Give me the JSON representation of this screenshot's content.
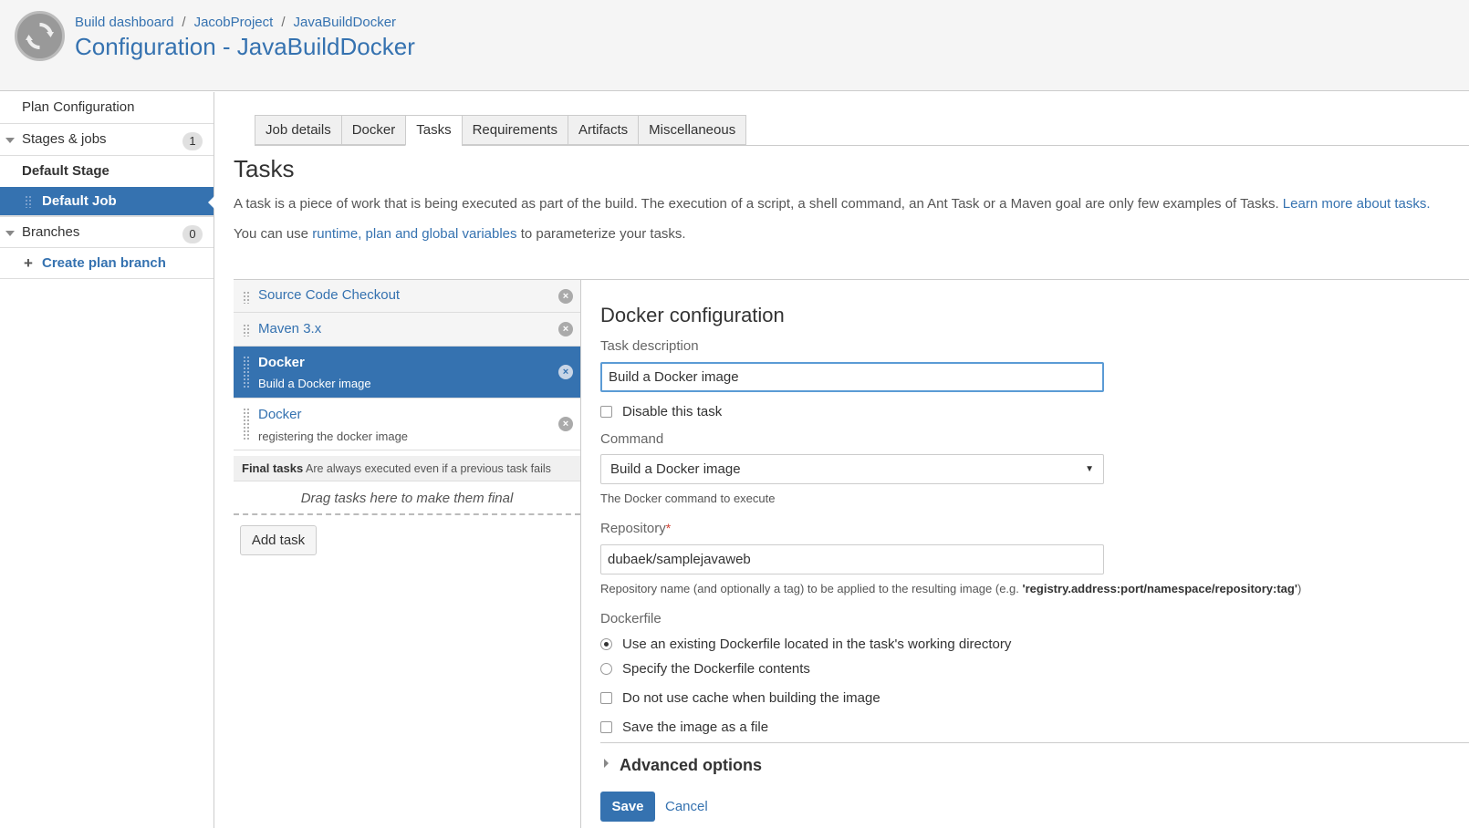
{
  "breadcrumb": {
    "items": [
      "Build dashboard",
      "JacobProject",
      "JavaBuildDocker"
    ],
    "separator": "/"
  },
  "page_title": "Configuration - JavaBuildDocker",
  "sidebar": {
    "plan_configuration": "Plan Configuration",
    "stages_jobs": {
      "label": "Stages & jobs",
      "count": "1"
    },
    "default_stage": "Default Stage",
    "default_job": "Default Job",
    "branches": {
      "label": "Branches",
      "count": "0"
    },
    "create_plan_branch": "Create plan branch"
  },
  "tabs": [
    "Job details",
    "Docker",
    "Tasks",
    "Requirements",
    "Artifacts",
    "Miscellaneous"
  ],
  "active_tab": "Tasks",
  "tasks_title": "Tasks",
  "description": {
    "line1_text": "A task is a piece of work that is being executed as part of the build. The execution of a script, a shell command, an Ant Task or a Maven goal are only few examples of Tasks.",
    "line1_link": "Learn more about tasks.",
    "line2_prefix": "You can use",
    "line2_link": "runtime, plan and global variables",
    "line2_suffix": "to parameterize your tasks."
  },
  "task_list": [
    {
      "name": "Source Code Checkout",
      "subtitle": ""
    },
    {
      "name": "Maven 3.x",
      "subtitle": ""
    },
    {
      "name": "Docker",
      "subtitle": "Build a Docker image"
    },
    {
      "name": "Docker",
      "subtitle": "registering the docker image"
    }
  ],
  "final_tasks": {
    "label": "Final tasks",
    "note": "Are always executed even if a previous task fails",
    "drop_hint": "Drag tasks here to make them final"
  },
  "add_task_label": "Add task",
  "config": {
    "title": "Docker configuration",
    "task_description_label": "Task description",
    "task_description_value": "Build a Docker image",
    "disable_task_label": "Disable this task",
    "command_label": "Command",
    "command_value": "Build a Docker image",
    "command_hint": "The Docker command to execute",
    "repository_label": "Repository",
    "repository_required_mark": "*",
    "repository_value": "dubaek/samplejavaweb",
    "repository_hint_prefix": "Repository name (and optionally a tag) to be applied to the resulting image (e.g.",
    "repository_hint_example": "'registry.address:port/namespace/repository:tag'",
    "repository_hint_suffix": ")",
    "dockerfile_label": "Dockerfile",
    "dockerfile_option_existing": "Use an existing Dockerfile located in the task's working directory",
    "dockerfile_option_specify": "Specify the Dockerfile contents",
    "no_cache_label": "Do not use cache when building the image",
    "save_file_label": "Save the image as a file",
    "advanced_options": "Advanced options",
    "save_label": "Save",
    "cancel_label": "Cancel"
  },
  "colors": {
    "accent": "#3572b0",
    "header_bg": "#f5f5f5",
    "required": "#d04437"
  }
}
